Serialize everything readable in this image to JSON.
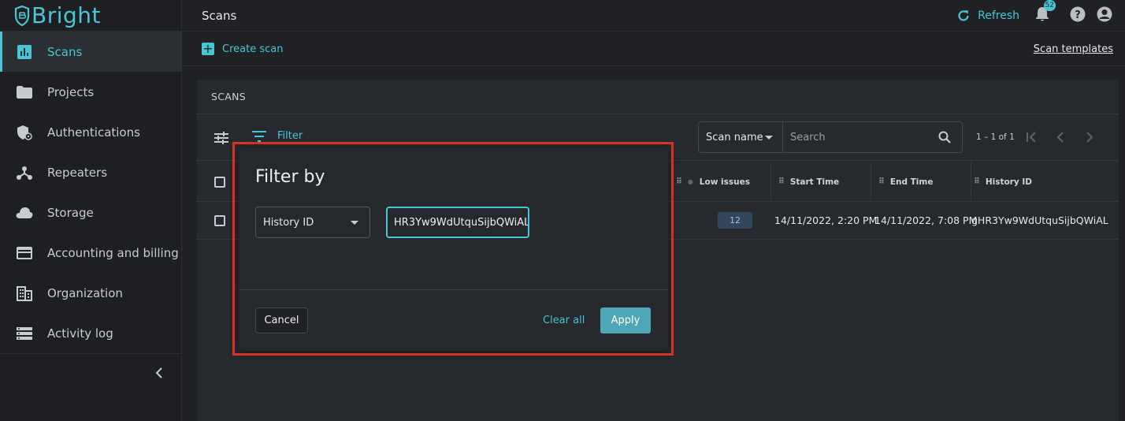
{
  "app": {
    "name": "Bright"
  },
  "sidebar": {
    "items": [
      {
        "label": "Scans",
        "icon": "bar-chart-icon",
        "active": true
      },
      {
        "label": "Projects",
        "icon": "folder-icon"
      },
      {
        "label": "Authentications",
        "icon": "shield-icon"
      },
      {
        "label": "Repeaters",
        "icon": "network-icon"
      },
      {
        "label": "Storage",
        "icon": "cloud-icon"
      },
      {
        "label": "Accounting and billing",
        "icon": "credit-card-icon"
      },
      {
        "label": "Organization",
        "icon": "building-icon"
      },
      {
        "label": "Activity log",
        "icon": "list-icon"
      }
    ],
    "collapse_icon": "chevron-left-icon"
  },
  "topbar": {
    "title": "Scans",
    "refresh_label": "Refresh",
    "notification_count": "52"
  },
  "actionbar": {
    "create_scan_label": "Create scan",
    "scan_templates_label": "Scan templates"
  },
  "panel": {
    "title": "SCANS",
    "filter_label": "Filter",
    "search_field": "Scan name",
    "search_placeholder": "Search",
    "pagination": "1 – 1 of 1",
    "columns": [
      "Low issues",
      "Start Time",
      "End Time",
      "History ID"
    ],
    "rows": [
      {
        "low_issues": "12",
        "start_time": "14/11/2022, 2:20 PM",
        "end_time": "14/11/2022, 7:08 PM",
        "history_id": "gHR3Yw9WdUtquSijbQWiAL"
      }
    ]
  },
  "modal": {
    "title": "Filter by",
    "field_select": "History ID",
    "field_value": "HR3Yw9WdUtquSijbQWiAL",
    "cancel_label": "Cancel",
    "clear_label": "Clear all",
    "apply_label": "Apply"
  },
  "colors": {
    "accent": "#49c6d4",
    "background": "#1f2125",
    "panel": "#26292d",
    "highlight": "#d93025"
  }
}
